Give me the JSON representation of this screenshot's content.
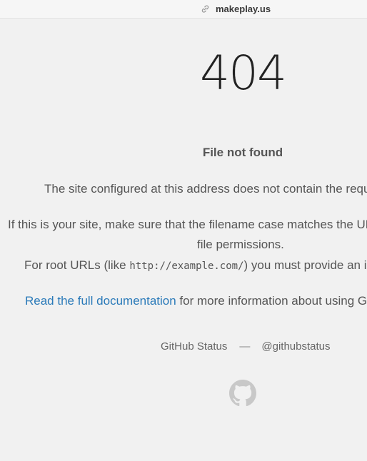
{
  "browser": {
    "url": "makeplay.us",
    "url_icon": "link-icon"
  },
  "error": {
    "code": "404",
    "title": "File not found"
  },
  "body": {
    "line1": "The site configured at this address does not contain the requested file.",
    "line2": "If this is your site, make sure that the filename case matches the URL as well as any",
    "line3": "file permissions.",
    "line4_prefix": "For root URLs (like ",
    "line4_code": "http://example.com/",
    "line4_suffix": ") you must provide an index.html file.",
    "doc_link": "Read the full documentation",
    "doc_suffix": " for more information about using GitHub Pages."
  },
  "footer": {
    "status_link": "GitHub Status",
    "separator": "—",
    "twitter_link": "@githubstatus",
    "logo_icon": "github-octocat-icon"
  },
  "colors": {
    "background": "#f1f1f1",
    "text": "#555555",
    "link": "#2a7ab9",
    "heading_404": "#222222"
  }
}
